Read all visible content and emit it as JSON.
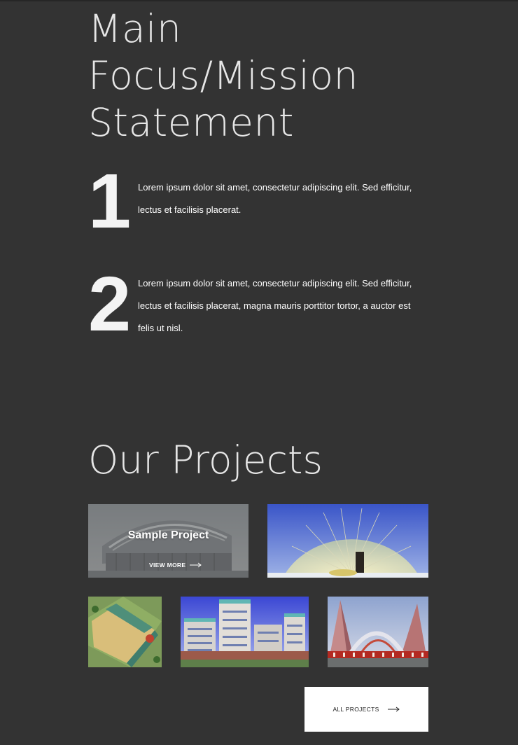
{
  "mission": {
    "title_lines": [
      "Main",
      "Focus/Mission",
      "Statement"
    ],
    "items": [
      {
        "number": "1",
        "text": "Lorem ipsum dolor sit amet, consectetur adipiscing elit. Sed efficitur, lectus et facilisis placerat."
      },
      {
        "number": "2",
        "text": "Lorem ipsum dolor sit amet, consectetur adipiscing elit. Sed efficitur, lectus et facilisis placerat, magna mauris porttitor tortor, a auctor est felis ut nisl."
      }
    ]
  },
  "projects": {
    "title": "Our Projects",
    "featured": {
      "caption": "Sample Project",
      "view_more": "VIEW MORE"
    },
    "all_projects_label": "ALL PROJECTS"
  },
  "colors": {
    "background": "#333333",
    "heading": "#e6e6e6",
    "button_bg": "#ffffff"
  }
}
